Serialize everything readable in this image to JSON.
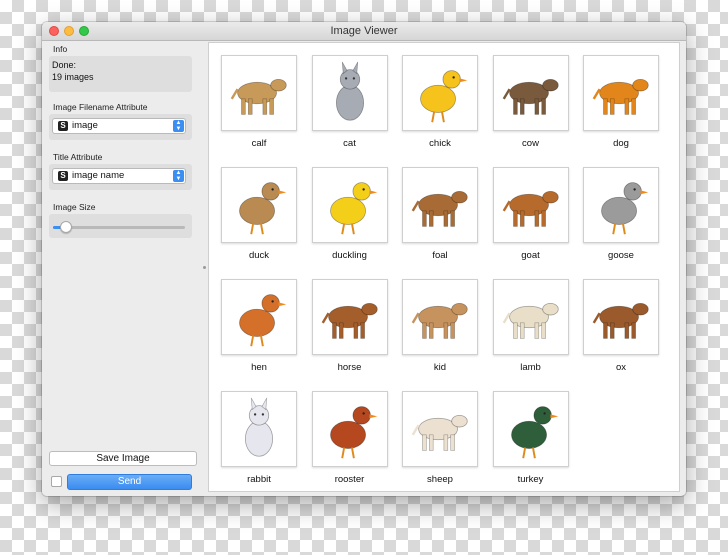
{
  "window": {
    "title": "Image Viewer"
  },
  "sidebar": {
    "info_label": "Info",
    "status_line1": "Done:",
    "status_line2": "19 images",
    "filename_label": "Image Filename Attribute",
    "filename_value": "image",
    "title_label": "Title Attribute",
    "title_value": "image name",
    "size_label": "Image Size",
    "size_slider_fraction": 0.1,
    "save_label": "Save Image",
    "send_label": "Send",
    "combo_badge": "S",
    "auto_send_checked": false
  },
  "images": [
    {
      "name": "calf",
      "color": "#c89a5a",
      "kind": "quad"
    },
    {
      "name": "cat",
      "color": "#a7acb4",
      "kind": "sit"
    },
    {
      "name": "chick",
      "color": "#f6c21c",
      "kind": "bird"
    },
    {
      "name": "cow",
      "color": "#7a5a3c",
      "kind": "quad"
    },
    {
      "name": "dog",
      "color": "#e2861b",
      "kind": "quad"
    },
    {
      "name": "duck",
      "color": "#b98a52",
      "kind": "bird"
    },
    {
      "name": "duckling",
      "color": "#f4cf1a",
      "kind": "bird"
    },
    {
      "name": "foal",
      "color": "#a86b35",
      "kind": "quad"
    },
    {
      "name": "goat",
      "color": "#b66b2c",
      "kind": "quad"
    },
    {
      "name": "goose",
      "color": "#9b9b9b",
      "kind": "bird"
    },
    {
      "name": "hen",
      "color": "#d4702a",
      "kind": "bird"
    },
    {
      "name": "horse",
      "color": "#a35e2b",
      "kind": "quad"
    },
    {
      "name": "kid",
      "color": "#c6935e",
      "kind": "quad"
    },
    {
      "name": "lamb",
      "color": "#e9dfc9",
      "kind": "quad"
    },
    {
      "name": "ox",
      "color": "#9a5a2c",
      "kind": "quad"
    },
    {
      "name": "rabbit",
      "color": "#e6e6ee",
      "kind": "sit"
    },
    {
      "name": "rooster",
      "color": "#b5481f",
      "kind": "bird"
    },
    {
      "name": "sheep",
      "color": "#ece0d0",
      "kind": "quad"
    },
    {
      "name": "turkey",
      "color": "#2e5f3a",
      "kind": "bird"
    }
  ]
}
